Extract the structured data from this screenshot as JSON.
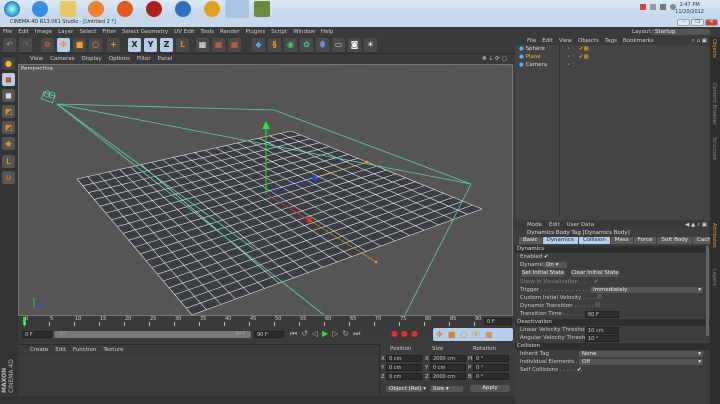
{
  "taskbar": {
    "clock_time": "1:47 PM",
    "clock_date": "11/20/2012"
  },
  "window": {
    "title": "CINEMA 4D R13.061 Studio - [Untitled 2 *]",
    "minimize": "–",
    "restore": "❐",
    "close": "✕"
  },
  "menu": [
    "File",
    "Edit",
    "Image",
    "Layer",
    "Select",
    "Filter",
    "Select Geometry",
    "UV Edit",
    "Tools",
    "Render",
    "Plugins",
    "Script",
    "Window",
    "Help"
  ],
  "layout": {
    "label": "Layout:",
    "value": "Startup"
  },
  "viewport": {
    "menu": [
      "View",
      "Cameras",
      "Display",
      "Options",
      "Filter",
      "Panel"
    ],
    "label": "Perspective"
  },
  "timeline": {
    "ticks": [
      "0",
      "5",
      "10",
      "15",
      "20",
      "25",
      "30",
      "35",
      "40",
      "45",
      "50",
      "55",
      "60",
      "65",
      "70",
      "75",
      "80",
      "85",
      "90"
    ],
    "current": "0 F",
    "start": "0 F",
    "range_start": "0 F",
    "range_end": "90 F",
    "end": "90 F"
  },
  "material_manager": {
    "menu": [
      "Create",
      "Edit",
      "Function",
      "Texture"
    ]
  },
  "brand": {
    "line1": "MAXON",
    "line2": "CINEMA 4D"
  },
  "coords": {
    "headers": [
      "Position",
      "Size",
      "Rotation"
    ],
    "rows": [
      {
        "a": "X",
        "p": "0 cm",
        "b": "X",
        "s": "2000 cm",
        "c": "H",
        "r": "0 °"
      },
      {
        "a": "Y",
        "p": "0 cm",
        "b": "Y",
        "s": "0 cm",
        "c": "P",
        "r": "0 °"
      },
      {
        "a": "Z",
        "p": "0 cm",
        "b": "Z",
        "s": "2000 cm",
        "c": "B",
        "r": "0 °"
      }
    ],
    "mode": "Object (Rel)",
    "size_mode": "Size",
    "apply": "Apply"
  },
  "objects": {
    "menu": [
      "File",
      "Edit",
      "View",
      "Objects",
      "Tags",
      "Bookmarks"
    ],
    "items": [
      {
        "name": "Sphere",
        "color": "#dddddd"
      },
      {
        "name": "Plane",
        "color": "#f0b030"
      },
      {
        "name": "Camera",
        "color": "#dddddd"
      }
    ]
  },
  "right_tabs": [
    "Objects",
    "Content Browser",
    "Structure",
    "Attributes",
    "Layers"
  ],
  "attributes": {
    "menu": [
      "Mode",
      "Edit",
      "User Data"
    ],
    "tag_title": "Dynamics Body Tag [Dynamics Body]",
    "tabs": [
      {
        "label": "Basic",
        "active": false
      },
      {
        "label": "Dynamics",
        "active": true
      },
      {
        "label": "Collision",
        "active": true
      },
      {
        "label": "Mass",
        "active": false
      },
      {
        "label": "Force",
        "active": false
      },
      {
        "label": "Soft Body",
        "active": false
      },
      {
        "label": "Cache",
        "active": false
      }
    ],
    "dynamics_section": "Dynamics",
    "enabled_label": "Enabled",
    "enabled_check": "✔",
    "dynamic_label": "Dynamic",
    "dynamic_value": "On",
    "set_initial": "Set Initial State",
    "clear_initial": "Clear Initial State",
    "show_vis": "Show in Visualization . . . .",
    "show_vis_check": "✔",
    "trigger_label": "Trigger . . . . . . . . . . . . . .",
    "trigger_value": "Immediately",
    "civ_label": "Custom Initial Velocity . . . .",
    "dyn_trans_label": "Dynamic Transition . . . . . .",
    "trans_time_label": "Transition Time . . . . . . . .",
    "trans_time_value": "60 F",
    "deactivation_section": "Deactivation",
    "lin_label": "Linear Velocity Threshold",
    "lin_value": "10 cm",
    "ang_label": "Angular Velocity Threshold",
    "ang_value": "10 °",
    "collision_section": "Collision",
    "inherit_label": "Inherit Tag",
    "inherit_value": "None",
    "indiv_label": "Individual Elements . . .",
    "indiv_value": "Off",
    "self_label": "Self Collisions . . . . . . .",
    "self_check": "✔"
  }
}
